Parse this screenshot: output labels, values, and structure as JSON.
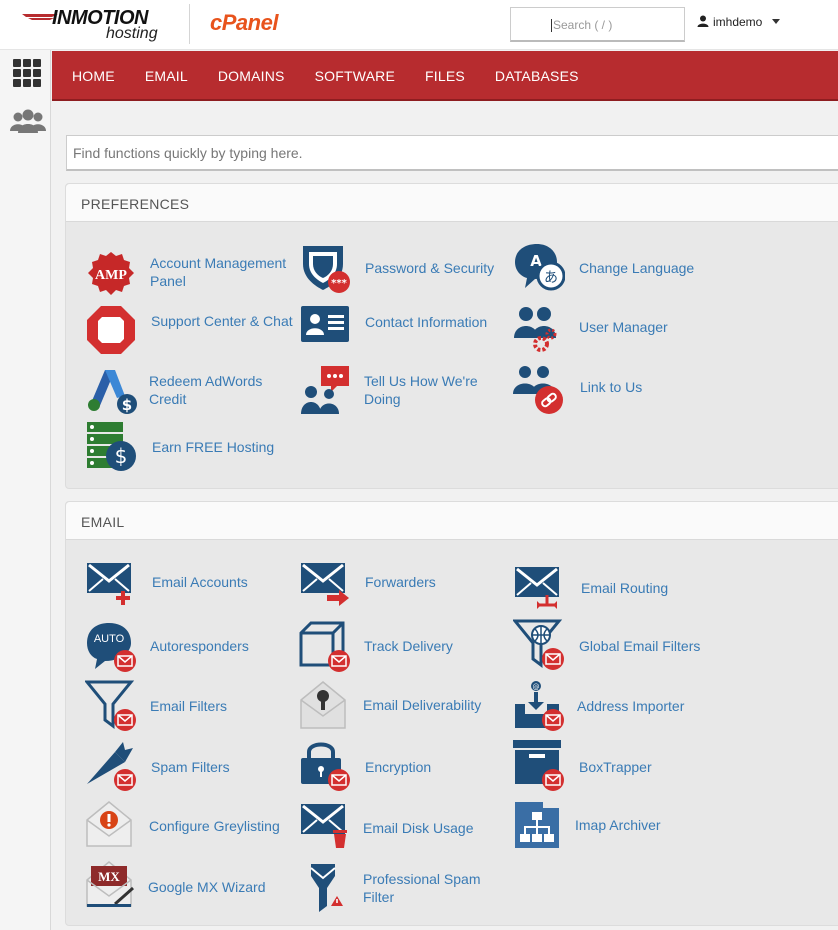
{
  "header": {
    "brand": "INMOTION",
    "brand_sub": "hosting",
    "product": "cPanel",
    "search_placeholder": "Search ( / )",
    "username": "imhdemo"
  },
  "nav": [
    "HOME",
    "EMAIL",
    "DOMAINS",
    "SOFTWARE",
    "FILES",
    "DATABASES"
  ],
  "quickfind_placeholder": "Find functions quickly by typing here.",
  "sections": {
    "preferences": {
      "title": "PREFERENCES",
      "items": [
        "Account Management Panel",
        "Password & Security",
        "Change Language",
        "Support Center & Chat",
        "Contact Information",
        "User Manager",
        "Redeem AdWords Credit",
        "Tell Us How We're Doing",
        "Link to Us",
        "Earn FREE Hosting"
      ]
    },
    "email": {
      "title": "EMAIL",
      "items": [
        "Email Accounts",
        "Forwarders",
        "Email Routing",
        "Autoresponders",
        "Track Delivery",
        "Global Email Filters",
        "Email Filters",
        "Email Deliverability",
        "Address Importer",
        "Spam Filters",
        "Encryption",
        "BoxTrapper",
        "Configure Greylisting",
        "Email Disk Usage",
        "Imap Archiver",
        "Google MX Wizard",
        "Professional Spam Filter"
      ]
    }
  },
  "icon_text": {
    "amp": "AMP",
    "auto": "AUTO",
    "mx": "MX"
  },
  "colors": {
    "nav_red": "#b72c2f",
    "icon_navy": "#1f4e79",
    "badge_red": "#d32f2f",
    "link_blue": "#3a7bb5",
    "cpanel_orange": "#e8531c"
  }
}
